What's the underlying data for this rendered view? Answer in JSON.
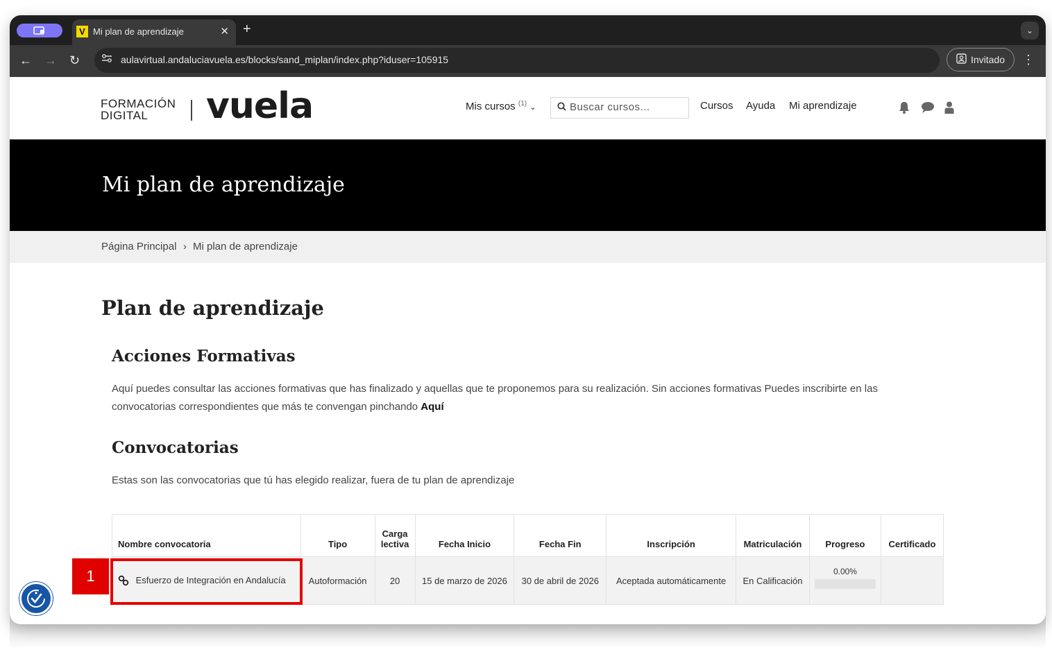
{
  "browser": {
    "tab_title": "Mi plan de aprendizaje",
    "tab_favicon": "V",
    "url": "aulavirtual.andaluciavuela.es/blocks/sand_miplan/index.php?iduser=105915",
    "profile_label": "Invitado",
    "icons": [
      "profile-switch-icon",
      "close-icon",
      "plus-icon",
      "chevron-down-icon",
      "back-icon",
      "forward-icon",
      "reload-icon",
      "site-settings-icon",
      "person-badge-icon",
      "kebab-icon"
    ]
  },
  "header": {
    "logo_small_line1": "FORMACIÓN",
    "logo_small_line2": "DIGITAL",
    "logo_big": "vuela",
    "mis_cursos": "Mis cursos",
    "mis_cursos_count": "(1)",
    "search_placeholder": "Buscar cursos...",
    "nav": [
      "Cursos",
      "Ayuda",
      "Mi aprendizaje"
    ],
    "icons": [
      "bell-icon",
      "chat-icon",
      "user-icon"
    ]
  },
  "hero": {
    "title": "Mi plan de aprendizaje"
  },
  "breadcrumb": {
    "home": "Página Principal",
    "separator": "›",
    "current": "Mi plan de aprendizaje"
  },
  "main": {
    "title": "Plan de aprendizaje",
    "acciones": {
      "heading": "Acciones Formativas",
      "text": "Aquí puedes consultar las acciones formativas que has finalizado y aquellas que te proponemos para su realización. Sin acciones formativas Puedes inscribirte en las convocatorias correspondientes que más te convengan pinchando ",
      "link": "Aquí"
    },
    "convocatorias": {
      "heading": "Convocatorias",
      "text": "Estas son las convocatorias que tú has elegido realizar, fuera de tu plan de aprendizaje"
    }
  },
  "table": {
    "headers": [
      "Nombre convocatoria",
      "Tipo",
      "Carga lectiva",
      "Fecha Inicio",
      "Fecha Fin",
      "Inscripción",
      "Matriculación",
      "Progreso",
      "Certificado"
    ],
    "row": {
      "nombre": "Esfuerzo de Integración en Andalucía",
      "tipo": "Autoformación",
      "carga": "20",
      "inicio": "15 de marzo de 2026",
      "fin": "30 de abril de 2026",
      "inscripcion": "Aceptada automáticamente",
      "matriculacion": "En Calificación",
      "progreso": "0.00%",
      "progreso_value": 0,
      "certificado": ""
    }
  },
  "annotation": {
    "marker": "1",
    "color": "#e00000"
  },
  "colors": {
    "hero_bg": "#000000",
    "accessibility": "#1755a6",
    "profile_pill": "#7d75f5"
  }
}
